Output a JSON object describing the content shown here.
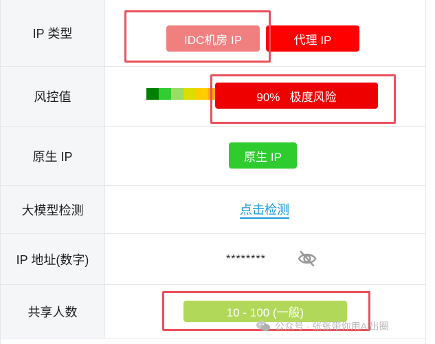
{
  "rows": {
    "ip_type": {
      "label": "IP 类型",
      "tag_idc": "IDC机房 IP",
      "tag_proxy": "代理 IP"
    },
    "risk": {
      "label": "风控值",
      "value": "90%   极度风险",
      "scale_colors": [
        "#008000",
        "#33cc33",
        "#99dd66",
        "#dddd00",
        "#ffcc00",
        "#ffaa00"
      ]
    },
    "native": {
      "label": "原生 IP",
      "tag": "原生 IP"
    },
    "llm_detect": {
      "label": "大模型检测",
      "link": "点击检测"
    },
    "ip_numeric": {
      "label": "IP 地址(数字)",
      "masked_value": "********",
      "icon": "eye-slash-icon"
    },
    "shared_users": {
      "label": "共享人数",
      "value": "10 - 100 (一般)"
    }
  },
  "watermark": {
    "text": "公众号 · 张张带你用AI出圈",
    "icon": "wechat-icon"
  },
  "colors": {
    "highlight": "#e8505b",
    "danger": "#ff0000",
    "success": "#2ecc2e",
    "link": "#1a9ad6"
  }
}
